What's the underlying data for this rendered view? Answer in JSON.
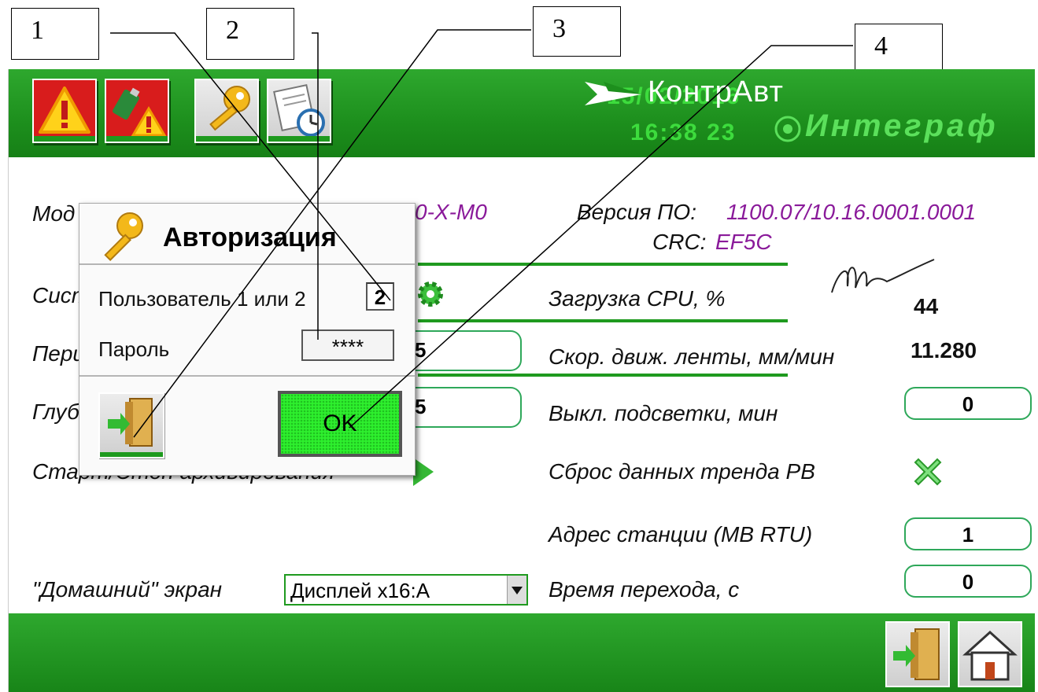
{
  "callouts": [
    "1",
    "2",
    "3",
    "4"
  ],
  "header": {
    "date": "15/02/2016",
    "time": "16:38 23",
    "brand_name": "КонтрАвт",
    "brand_sub": "Интеграф"
  },
  "info": {
    "model_label": "Мод",
    "model_value": "0-X-M0",
    "version_label": "Версия ПО:",
    "version_value": "1100.07/10.16.0001.0001",
    "crc_label": "CRC:",
    "crc_value": "EF5C"
  },
  "left_labels": {
    "system": "Сист",
    "period": "Пери",
    "depth": "Глуб",
    "archive": "Старт/Стоп архивирования",
    "home_screen": "\"Домашний\" экран"
  },
  "left_partial_values": {
    "period": "5",
    "depth": "5"
  },
  "home_screen_select": "Дисплей x16:A",
  "right_rows": [
    {
      "label": "Загрузка CPU, %",
      "value": "44"
    },
    {
      "label": "Скор. движ. ленты, мм/мин",
      "value": "11.280"
    },
    {
      "label": "Выкл. подсветки, мин",
      "value": "0"
    },
    {
      "label": "Сброс данных тренда РВ",
      "value": ""
    },
    {
      "label": "Адрес станции (MB RTU)",
      "value": "1"
    },
    {
      "label": "Время перехода, с",
      "value": "0"
    }
  ],
  "dialog": {
    "title": "Авторизация",
    "user_label": "Пользователь 1 или 2",
    "user_value": "2",
    "password_label": "Пароль",
    "password_value": "****",
    "ok_label": "OK"
  },
  "colors": {
    "accent_green": "#1f9a1f",
    "date_green": "#3ddc3d",
    "value_purple": "#8a1a9a",
    "ok_green": "#2ef02e",
    "alarm_red": "#d81c1c"
  }
}
